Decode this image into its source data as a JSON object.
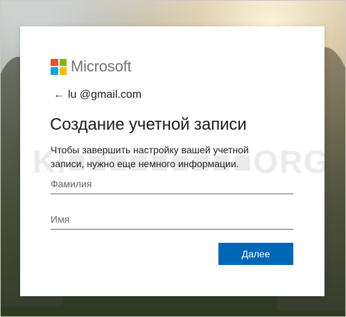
{
  "page": {
    "watermark": "KI■■■■■■■■■ORG"
  },
  "branding": {
    "logo_icon": "microsoft-logo-icon",
    "name": "Microsoft",
    "colors": {
      "red": "#f25022",
      "green": "#7fba00",
      "blue": "#00a4ef",
      "yellow": "#ffb900",
      "button_blue": "#0067b8"
    }
  },
  "identity": {
    "back_icon": "←",
    "email": "lu                    @gmail.com"
  },
  "form": {
    "title": "Создание учетной записи",
    "description": "Чтобы завершить настройку вашей учетной записи, нужно еще немного информации.",
    "last_name_placeholder": "Фамилия",
    "first_name_placeholder": "Имя",
    "next_label": "Далее"
  }
}
